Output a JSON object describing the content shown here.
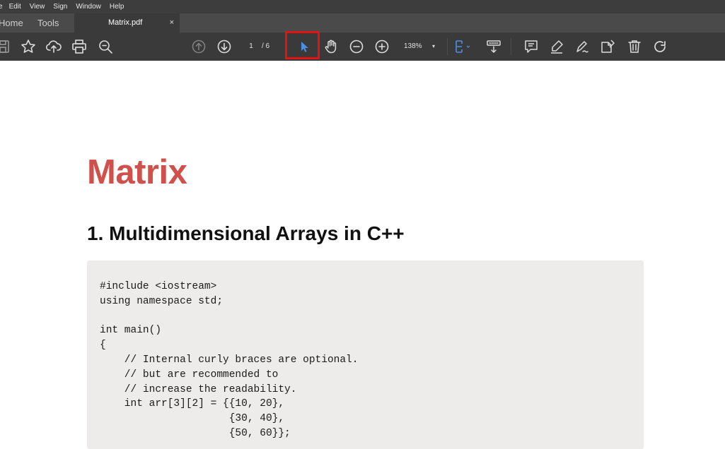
{
  "menu": {
    "items": [
      "e",
      "Edit",
      "View",
      "Sign",
      "Window",
      "Help"
    ]
  },
  "tabs": {
    "home": "Home",
    "tools": "Tools",
    "doc_title": "Matrix.pdf",
    "close": "×"
  },
  "toolbar": {
    "page_current": "1",
    "page_total": "/ 6",
    "zoom": "138%",
    "zoom_caret": "▾",
    "accent_color": "#4a90e2",
    "highlight_color": "#e11414"
  },
  "document": {
    "title": "Matrix",
    "heading": "1. Multidimensional Arrays in C++",
    "code_lines": [
      "#include <iostream>",
      "using namespace std;",
      "",
      "int main()",
      "{",
      "    // Internal curly braces are optional.",
      "    // but are recommended to",
      "    // increase the readability.",
      "    int arr[3][2] = {{10, 20},",
      "                     {30, 40},",
      "                     {50, 60}};"
    ]
  }
}
